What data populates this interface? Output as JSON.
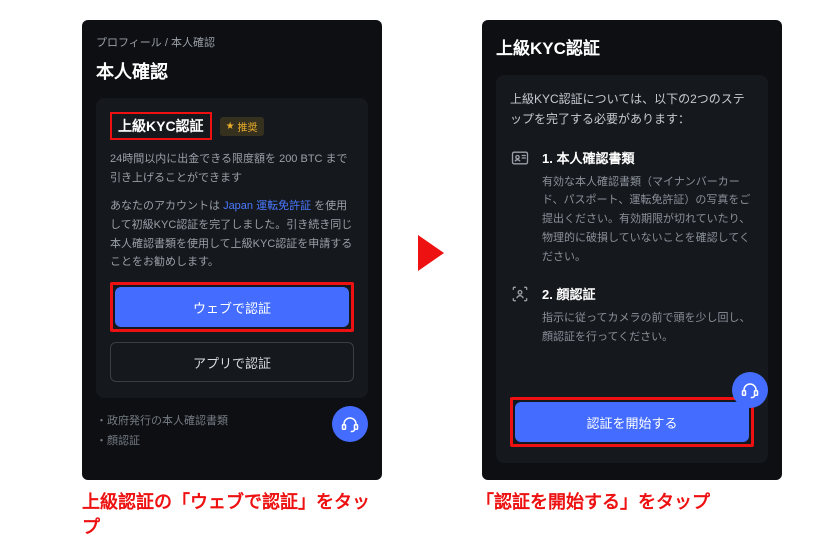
{
  "left": {
    "breadcrumb": "プロフィール / 本人確認",
    "page_title": "本人確認",
    "kyc_title": "上級KYC認証",
    "badge": "推奨",
    "limit_text": "24時間以内に出金できる限度額を 200 BTC まで引き上げることができます",
    "account_prefix": "あなたのアカウントは ",
    "account_hl": "Japan 運転免許証",
    "account_suffix": " を使用して初級KYC認証を完了しました。引き続き同じ本人確認書類を使用して上級KYC認証を申請することをお勧めします。",
    "btn_web": "ウェブで認証",
    "btn_app": "アプリで認証",
    "bullet1": "・政府発行の本人確認書類",
    "bullet2": "・顔認証"
  },
  "right": {
    "title": "上級KYC認証",
    "intro": "上級KYC認証については、以下の2つのステップを完了する必要があります：",
    "step1_title": "1. 本人確認書類",
    "step1_desc": "有効な本人確認書類（マイナンバーカード、パスポート、運転免許証）の写真をご提出ください。有効期限が切れていたり、物理的に破損していないことを確認してください。",
    "step2_title": "2. 顔認証",
    "step2_desc": "指示に従ってカメラの前で頭を少し回し、顔認証を行ってください。",
    "btn_start": "認証を開始する"
  },
  "captions": {
    "left": "上級認証の「ウェブで認証」をタップ",
    "right": "「認証を開始する」をタップ"
  }
}
